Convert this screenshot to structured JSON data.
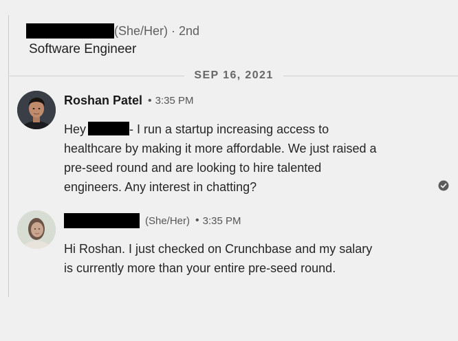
{
  "header": {
    "pronouns_degree": "(She/Her) · 2nd",
    "headline": "Software Engineer"
  },
  "date_separator": "SEP 16, 2021",
  "messages": [
    {
      "sender": "Roshan Patel",
      "time": "3:35 PM",
      "text_start": "Hey",
      "text_rest": "- I run a startup increasing access to healthcare by making it more affordable. We just raised a pre-seed round and are looking to hire talented engineers. Any interest in chatting?",
      "status_icon": "read-receipt-check-icon"
    },
    {
      "pronouns": "(She/Her)",
      "time": "3:35 PM",
      "text": "Hi Roshan. I just checked on Crunchbase and my salary is currently more than your entire pre-seed round."
    }
  ],
  "colors": {
    "background": "#f0f0f0",
    "redaction": "#000000",
    "secondary_text": "#555555"
  }
}
